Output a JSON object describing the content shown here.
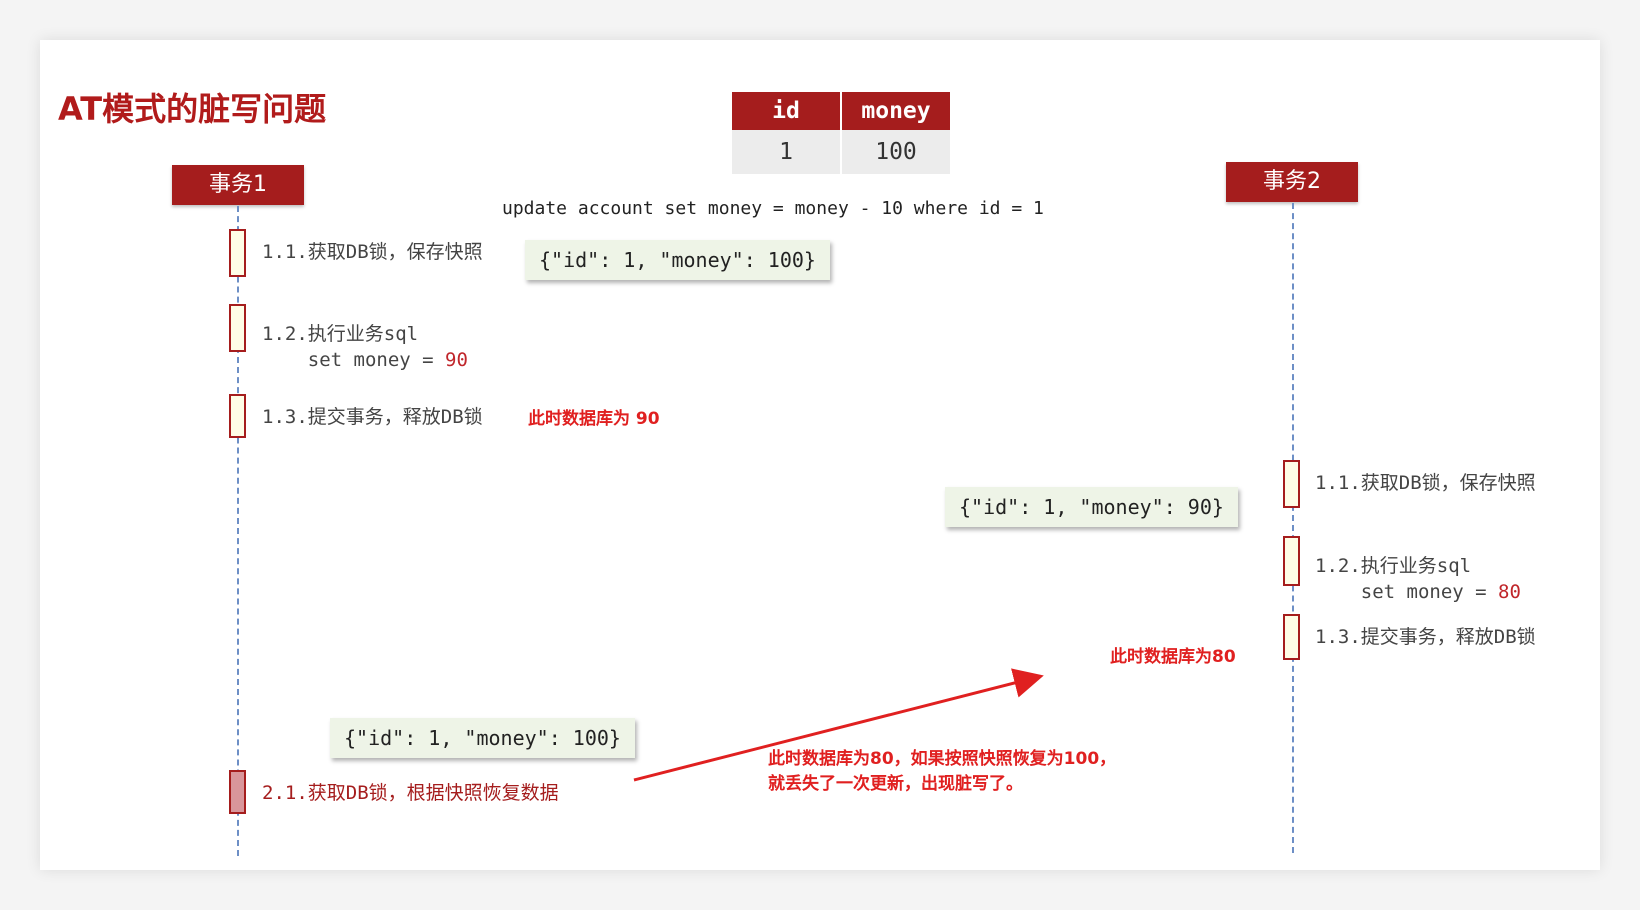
{
  "title": "AT模式的脏写问题",
  "table": {
    "headers": [
      "id",
      "money"
    ],
    "row": [
      "1",
      "100"
    ]
  },
  "sql": "update account set money = money - 10 where id = 1",
  "txn1": {
    "label": "事务1",
    "step1": "1.1.获取DB锁，保存快照",
    "step2_line1": "1.2.执行业务sql",
    "step2_line2_prefix": "    set money = ",
    "step2_value": "90",
    "step3": "1.3.提交事务，释放DB锁",
    "step4": "2.1.获取DB锁，根据快照恢复数据",
    "snapshot_top": "{\"id\": 1, \"money\": 100}",
    "snapshot_bottom": "{\"id\": 1, \"money\": 100}",
    "note": "此时数据库为 90"
  },
  "txn2": {
    "label": "事务2",
    "step1": "1.1.获取DB锁，保存快照",
    "step2_line1": "1.2.执行业务sql",
    "step2_line2_prefix": "    set money = ",
    "step2_value": "80",
    "step3": "1.3.提交事务，释放DB锁",
    "snapshot": "{\"id\": 1, \"money\": 90}",
    "note": "此时数据库为80"
  },
  "arrow_note": {
    "line1": "此时数据库为80，如果按照快照恢复为100，",
    "line2": "就丢失了一次更新，出现脏写了。"
  },
  "colors": {
    "primary_red": "#a51d1d",
    "note_red": "#e02020",
    "lifeline": "#6d8fc6",
    "snapshot_bg": "#eef4e7"
  }
}
